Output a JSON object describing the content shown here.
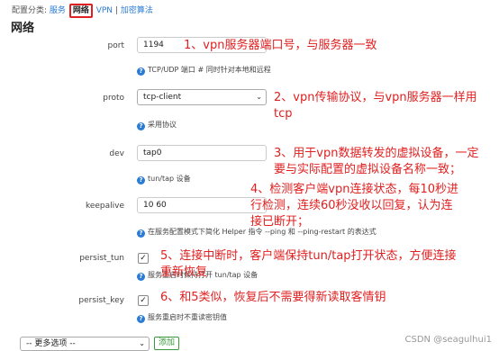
{
  "breadcrumb": {
    "prefix": "配置分类:",
    "items": [
      "服务",
      "网络",
      "VPN",
      "加密算法"
    ],
    "separator": "|"
  },
  "section_title": "网络",
  "fields": {
    "port": {
      "label": "port",
      "value": "1194",
      "help": "TCP/UDP 端口 # 同时针对本地和远程"
    },
    "proto": {
      "label": "proto",
      "value": "tcp-client",
      "help": "采用协议"
    },
    "dev": {
      "label": "dev",
      "value": "tap0",
      "help": "tun/tap 设备"
    },
    "keepalive": {
      "label": "keepalive",
      "value": "10 60",
      "help": "在服务配置模式下简化 Helper 指令 --ping 和 --ping-restart 的表达式"
    },
    "persist_tun": {
      "label": "persist_tun",
      "checked": true,
      "help": "服务重启时保持打开 tun/tap 设备"
    },
    "persist_key": {
      "label": "persist_key",
      "checked": true,
      "help": "服务重启时不重读密钥值"
    }
  },
  "notes": {
    "n1": "1、vpn服务器端口号，与服务器一致",
    "n2a": "2、vpn传输协议，与vpn服务器一样用",
    "n2b": "tcp",
    "n3a": "3、用于vpn数据转发的虚拟设备，一定",
    "n3b": "要与实际配置的虚拟设备名称一致；",
    "n4a": "4、检测客户端vpn连接状态，每10秒进",
    "n4b": "行检测，连续60秒没收以回复，认为连",
    "n4c": "接已断开；",
    "n5a": "5、连接中断时，客户端保持tun/tap打开状态，方便连接",
    "n5b": "重新恢复",
    "n6": "6、和5类似，恢复后不需要得新读取客情钥"
  },
  "footer": {
    "more_options": "-- 更多选项 --",
    "add_label": "添加",
    "watermark": "CSDN @seagulhui1"
  },
  "colors": {
    "accent": "#2a7bd5",
    "annotation": "#e02020",
    "add": "#3a9a3a"
  }
}
